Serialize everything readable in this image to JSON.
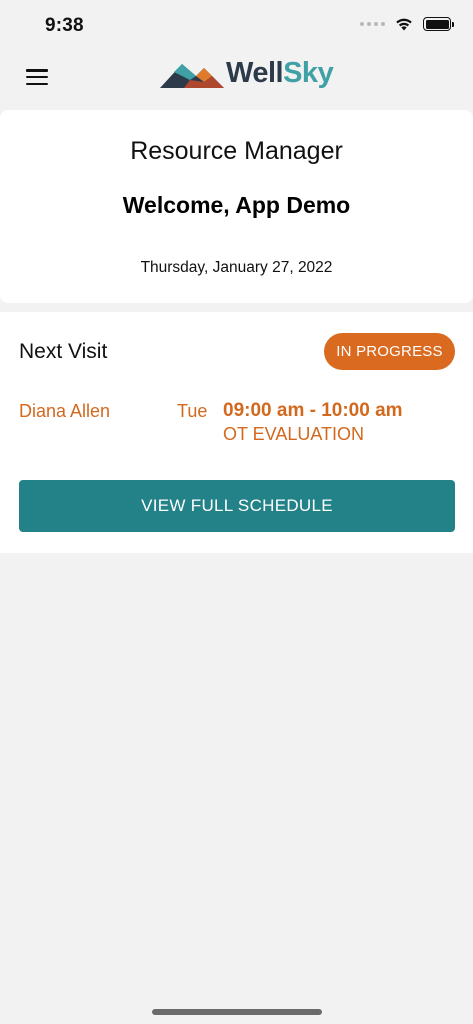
{
  "status_bar": {
    "time": "9:38",
    "icons": [
      "signal-icon",
      "wifi-icon",
      "battery-icon"
    ]
  },
  "nav": {
    "menu_icon": "hamburger-menu-icon",
    "logo": {
      "part1": "Well",
      "part2": "Sky",
      "colors": {
        "dark": "#2d3a4a",
        "teal": "#3fa0a5",
        "orange": "#e07a2c"
      }
    }
  },
  "welcome": {
    "title": "Resource Manager",
    "greeting": "Welcome, App Demo",
    "date": "Thursday, January 27, 2022"
  },
  "next_visit": {
    "heading": "Next Visit",
    "status": "IN PROGRESS",
    "client_name": "Diana Allen",
    "day": "Tue",
    "time": "09:00 am - 10:00 am",
    "visit_type": "OT EVALUATION",
    "button_label": "VIEW FULL SCHEDULE"
  },
  "colors": {
    "accent_orange": "#d96a20",
    "primary_teal": "#238288",
    "background": "#f2f2f2"
  }
}
